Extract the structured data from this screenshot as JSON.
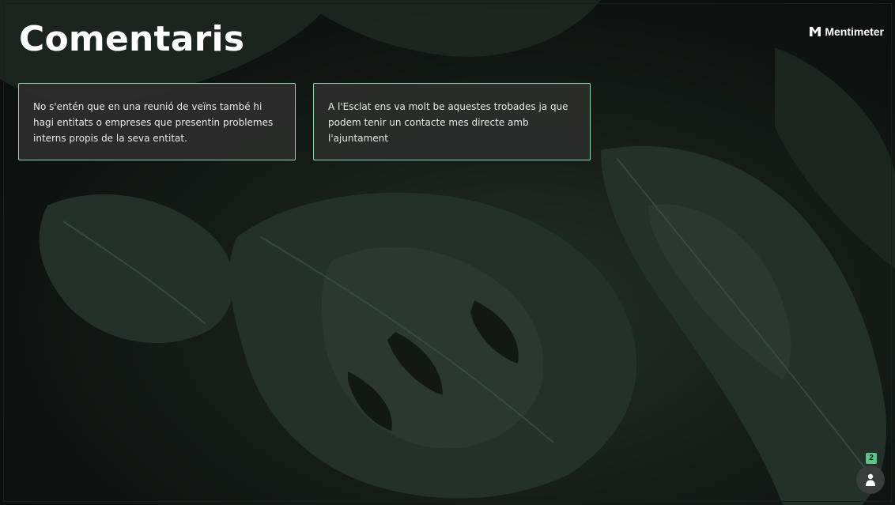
{
  "slide": {
    "title": "Comentaris"
  },
  "brand": {
    "name": "Mentimeter",
    "icon": "mentimeter-logo-icon"
  },
  "comments": [
    {
      "text": "No s'entén que en una reunió de veïns també hi hagi entitats o empreses que presentin problemes interns propis de la seva entitat."
    },
    {
      "text": "A l'Esclat ens va molt be aquestes trobades ja que podem tenir un contacte mes directe amb l'ajuntament"
    }
  ],
  "participants": {
    "count": "2",
    "icon": "person-icon"
  },
  "colors": {
    "card_border": "#8fd6b0",
    "card_background": "#2c2e2d",
    "badge": "#5ec48a"
  }
}
